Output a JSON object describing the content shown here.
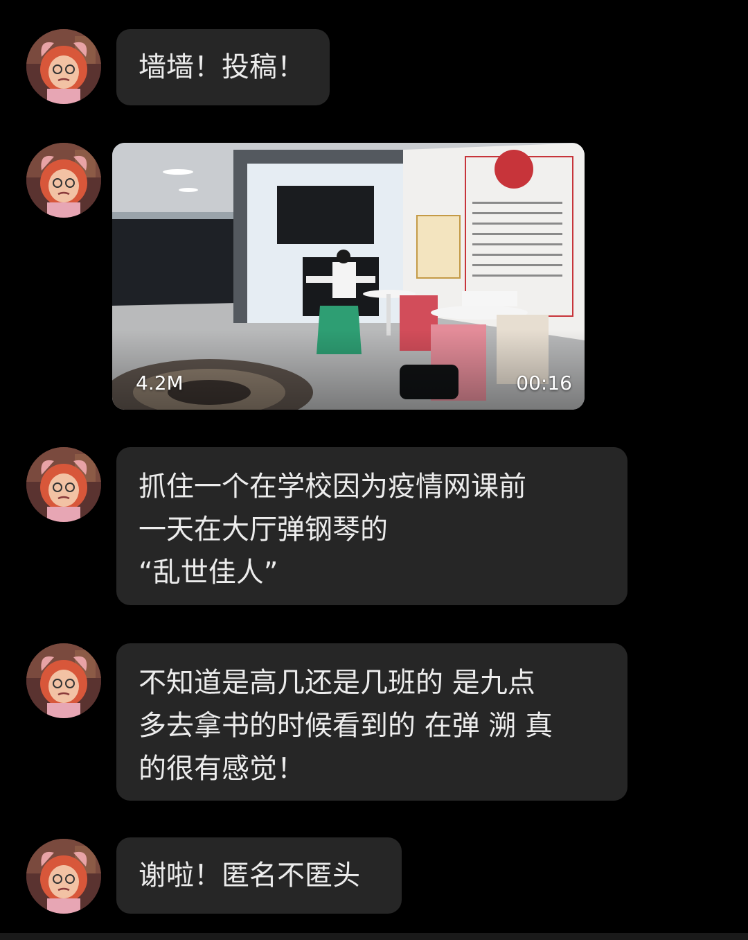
{
  "messages": [
    {
      "type": "text",
      "text": "墙墙！投稿！"
    },
    {
      "type": "video",
      "size": "4.2M",
      "duration": "00:16"
    },
    {
      "type": "text",
      "text": "抓住一个在学校因为疫情网课前\n一天在大厅弹钢琴的\n“乱世佳人”"
    },
    {
      "type": "text",
      "text": "不知道是高几还是几班的 是九点\n多去拿书的时候看到的 在弹 溯 真\n的很有感觉！"
    },
    {
      "type": "text",
      "text": "谢啦！匿名不匿头"
    }
  ],
  "colors": {
    "background": "#000000",
    "bubble": "#262626",
    "text": "#ececec"
  },
  "icons": {
    "avatar": "cartoon-girl-avatar"
  }
}
